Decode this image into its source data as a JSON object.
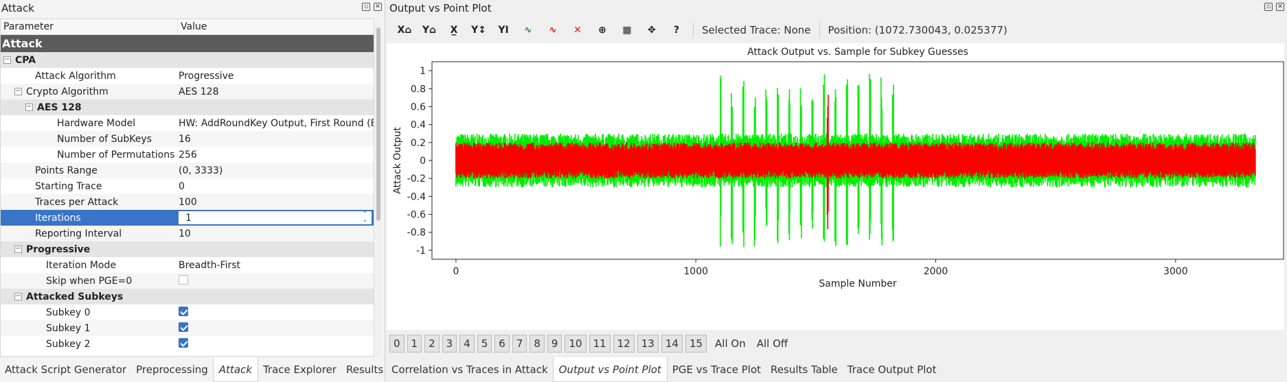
{
  "left_dock": {
    "title": "Attack",
    "headers": {
      "param": "Parameter",
      "value": "Value"
    },
    "rows": [
      {
        "label": "Attack",
        "value": "",
        "kind": "attack",
        "indent": 0
      },
      {
        "label": "CPA",
        "value": "",
        "kind": "group",
        "indent": 0,
        "expander": true
      },
      {
        "label": "Attack Algorithm",
        "value": "Progressive",
        "kind": "normal",
        "indent": 2
      },
      {
        "label": "Crypto Algorithm",
        "value": "AES 128",
        "kind": "alt",
        "indent": 1,
        "expander": true
      },
      {
        "label": "AES 128",
        "value": "",
        "kind": "group",
        "indent": 2,
        "expander": true
      },
      {
        "label": "Hardware Model",
        "value": "HW: AddRoundKey Output, First Round (En",
        "kind": "normal",
        "indent": 4
      },
      {
        "label": "Number of SubKeys",
        "value": "16",
        "kind": "alt",
        "indent": 4
      },
      {
        "label": "Number of Permutations",
        "value": "256",
        "kind": "normal",
        "indent": 4
      },
      {
        "label": "Points Range",
        "value": "(0, 3333)",
        "kind": "alt",
        "indent": 2
      },
      {
        "label": "Starting Trace",
        "value": "0",
        "kind": "normal",
        "indent": 2
      },
      {
        "label": "Traces per Attack",
        "value": "100",
        "kind": "alt",
        "indent": 2
      },
      {
        "label": "Iterations",
        "value": "1",
        "kind": "sel",
        "indent": 2
      },
      {
        "label": "Reporting Interval",
        "value": "10",
        "kind": "alt",
        "indent": 2
      },
      {
        "label": "Progressive",
        "value": "",
        "kind": "group",
        "indent": 1,
        "expander": true
      },
      {
        "label": "Iteration Mode",
        "value": "Breadth-First",
        "kind": "normal",
        "indent": 3
      },
      {
        "label": "Skip when PGE=0",
        "value": "",
        "kind": "alt",
        "indent": 3,
        "check": false
      },
      {
        "label": "Attacked Subkeys",
        "value": "",
        "kind": "group",
        "indent": 1,
        "expander": true
      },
      {
        "label": "Subkey 0",
        "value": "",
        "kind": "normal",
        "indent": 3,
        "check": true
      },
      {
        "label": "Subkey 1",
        "value": "",
        "kind": "alt",
        "indent": 3,
        "check": true
      },
      {
        "label": "Subkey 2",
        "value": "",
        "kind": "normal",
        "indent": 3,
        "check": true
      }
    ],
    "tabs": [
      "Attack Script Generator",
      "Preprocessing",
      "Attack",
      "Trace Explorer",
      "Results"
    ],
    "active_tab": "Attack"
  },
  "right_dock": {
    "title": "Output vs Point Plot",
    "toolbar": {
      "buttons": [
        {
          "glyph": "X⌂",
          "icon": "x-zoom-icon"
        },
        {
          "glyph": "Y⌂",
          "icon": "y-zoom-icon"
        },
        {
          "glyph": "X̲",
          "icon": "x-autoscale-icon"
        },
        {
          "glyph": "Y↕",
          "icon": "y-autoscale-icon"
        },
        {
          "glyph": "YI",
          "icon": "y-limit-icon"
        },
        {
          "glyph": "∿",
          "icon": "show-all-traces-icon",
          "color": "#2e8b2e"
        },
        {
          "glyph": "∿",
          "icon": "highlight-trace-icon",
          "color": "#d22"
        },
        {
          "glyph": "✕",
          "icon": "clear-traces-icon",
          "color": "#d22"
        },
        {
          "glyph": "⊕",
          "icon": "crosshair-icon"
        },
        {
          "glyph": "▦",
          "icon": "grid-icon"
        },
        {
          "glyph": "✥",
          "icon": "pan-icon"
        },
        {
          "glyph": "?",
          "icon": "help-icon"
        }
      ],
      "selected_trace": "Selected Trace: None",
      "position": "Position: (1072.730043, 0.025377)"
    },
    "trace_buttons": [
      "0",
      "1",
      "2",
      "3",
      "4",
      "5",
      "6",
      "7",
      "8",
      "9",
      "10",
      "11",
      "12",
      "13",
      "14",
      "15"
    ],
    "all_on": "All On",
    "all_off": "All Off",
    "tabs": [
      "Correlation vs Traces in Attack",
      "Output vs Point Plot",
      "PGE vs Trace Plot",
      "Results Table",
      "Trace Output Plot"
    ],
    "active_tab": "Output vs Point Plot"
  },
  "chart_data": {
    "type": "line",
    "title": "Attack Output vs. Sample for Subkey Guesses",
    "xlabel": "Sample Number",
    "ylabel": "Attack Output",
    "xlim": [
      -100,
      3450
    ],
    "ylim": [
      -1.1,
      1.1
    ],
    "xticks": [
      0,
      1000,
      2000,
      3000
    ],
    "yticks": [
      1,
      0.8,
      0.6,
      0.4,
      0.2,
      0,
      -0.2,
      -0.4,
      -0.6,
      -0.8,
      -1
    ],
    "x_range": [
      0,
      3333
    ],
    "series": [
      {
        "color": "#00ee00",
        "base_amplitude": 0.3,
        "envelope": [
          [
            0,
            0.3
          ],
          [
            1100,
            0.3
          ],
          [
            1100,
            0.97
          ],
          [
            1830,
            0.97
          ],
          [
            1830,
            0.3
          ],
          [
            3333,
            0.3
          ]
        ]
      },
      {
        "color": "#ff0000",
        "base_amplitude": 0.2,
        "peak": [
          1550,
          0.77
        ]
      }
    ]
  }
}
